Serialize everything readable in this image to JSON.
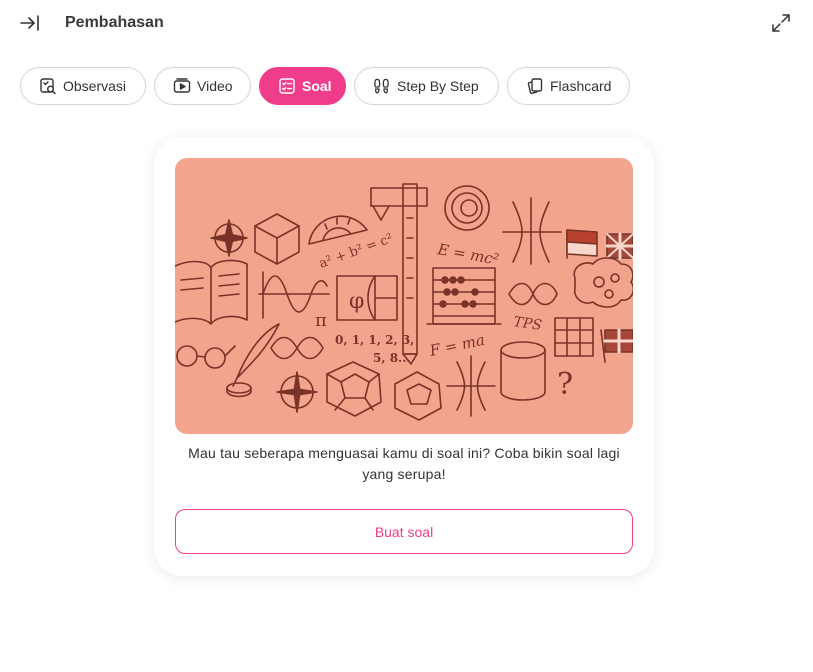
{
  "header": {
    "title": "Pembahasan",
    "collapse_icon": "collapse-right-icon",
    "expand_icon": "expand-icon"
  },
  "tabs": [
    {
      "label": "Observasi",
      "icon": "search-document-icon",
      "active": false
    },
    {
      "label": "Video",
      "icon": "play-icon",
      "active": false
    },
    {
      "label": "Soal",
      "icon": "checklist-icon",
      "active": true
    },
    {
      "label": "Step By Step",
      "icon": "footsteps-icon",
      "active": false
    },
    {
      "label": "Flashcard",
      "icon": "cards-icon",
      "active": false
    }
  ],
  "card": {
    "illustration_text": {
      "pythagoras": "a² + b² = c²",
      "einstein": "E = mc²",
      "fibonacci": "0, 1, 1, 2, 3,",
      "fibonacci2": "5, 8...",
      "newton": "F = ma",
      "tps": "TPS",
      "pi": "π",
      "phi": "φ",
      "question": "?"
    },
    "description": "Mau tau seberapa menguasai kamu di soal ini? Coba bikin soal lagi yang serupa!",
    "button_label": "Buat soal"
  },
  "colors": {
    "accent": "#ef3d8b",
    "illustration_bg": "#f2a48d",
    "illustration_ink": "#7a3328"
  }
}
